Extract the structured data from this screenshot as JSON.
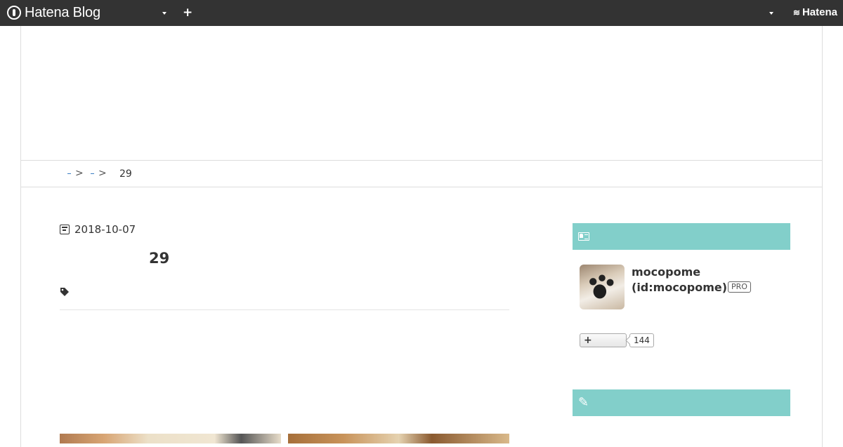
{
  "globalbar": {
    "logo_text": "Hatena Blog",
    "add_label": "+",
    "hatena_label": "Hatena"
  },
  "breadcrumb": {
    "separator": ">",
    "current": "29"
  },
  "entry": {
    "date": "2018-10-07",
    "title": "29"
  },
  "profile": {
    "name": "mocopome",
    "id": "(id:mocopome)",
    "badge": "PRO",
    "follow_label": "+",
    "follower_count": "144"
  },
  "colors": {
    "globalbar_bg": "#333333",
    "module_head": "#82cfca"
  }
}
